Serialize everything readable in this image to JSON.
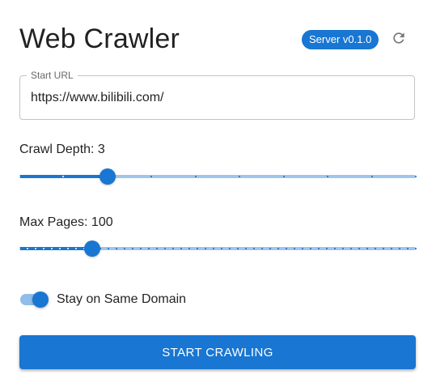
{
  "header": {
    "title": "Web Crawler",
    "server_badge": "Server v0.1.0",
    "refresh_icon": "refresh-icon"
  },
  "start_url": {
    "label": "Start URL",
    "value": "https://www.bilibili.com/",
    "placeholder": ""
  },
  "crawl_depth": {
    "label": "Crawl Depth: 3",
    "value": 3,
    "min": 1,
    "max": 10,
    "step": 1
  },
  "max_pages": {
    "label": "Max Pages: 100",
    "value": 100,
    "min": 10,
    "max": 500,
    "step": 10
  },
  "same_domain": {
    "label": "Stay on Same Domain",
    "checked": true
  },
  "start_button": {
    "label": "START CRAWLING"
  },
  "colors": {
    "primary": "#1976d2",
    "rail": "#9fc5ec",
    "switch_track": "#90bde9"
  }
}
